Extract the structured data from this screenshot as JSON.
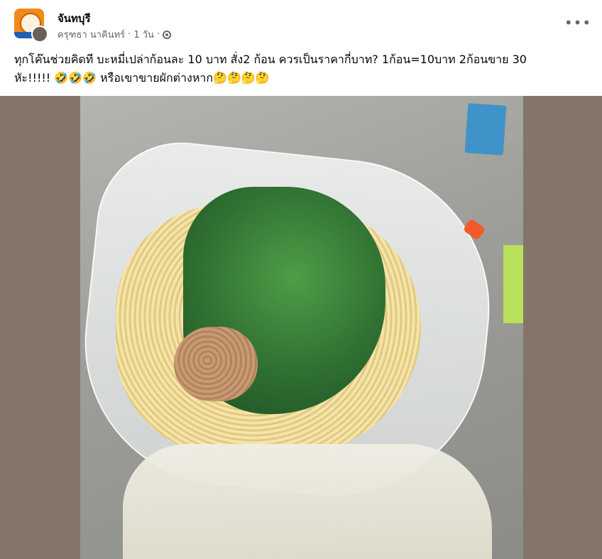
{
  "page": {
    "name": "จันทบุรี",
    "author": "ครุฑธา นาคินทร์",
    "time": "1 วัน",
    "separator": "·"
  },
  "post": {
    "line1": "ทุกโค๊นช่วยคิดที บะหมี่เปล่าก้อนละ 10 บาท สั่ง2 ก้อน ควรเป็นราคากี่บาท?  1ก้อน=10บาท  2ก้อนขาย 30",
    "line2": "หัะ!!!!! 🤣🤣🤣 หรือเขาขายผักต่างหาก🤔🤔🤔🤔"
  },
  "icons": {
    "more": "more-icon",
    "privacy": "globe-icon"
  }
}
